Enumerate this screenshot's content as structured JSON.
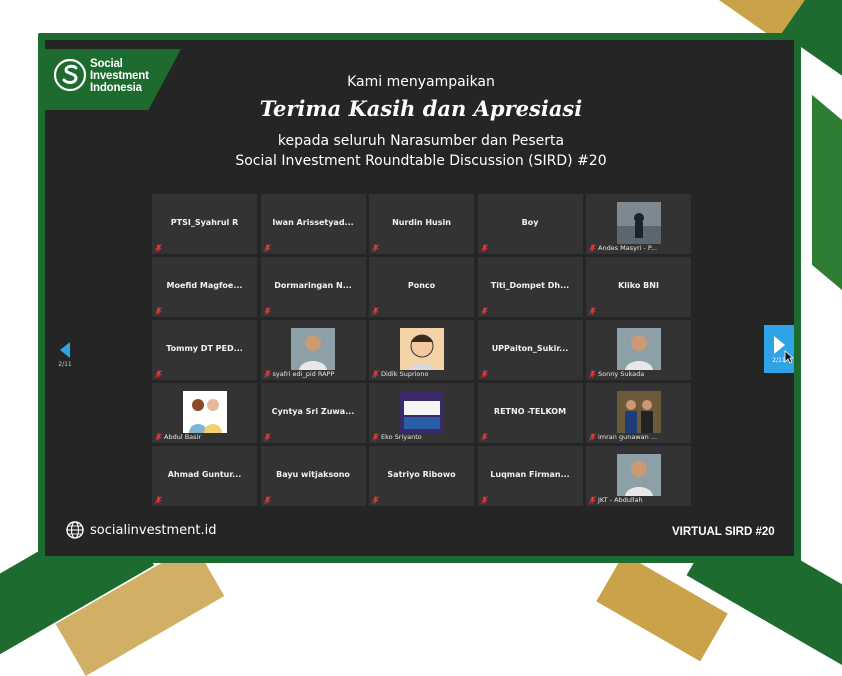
{
  "brand": {
    "logo_lines": [
      "Social",
      "Investment",
      "Indonesia"
    ],
    "green": "#1d6b2f",
    "gold": "#c9a24a"
  },
  "heading": {
    "line1": "Kami menyampaikan",
    "line2": "Terima Kasih dan Apresiasi",
    "line3": "kepada seluruh Narasumber dan Peserta",
    "line4": "Social Investment Roundtable Discussion (SIRD) #20"
  },
  "navigation": {
    "prev_page": "2/11",
    "next_page": "2/11"
  },
  "participants": [
    {
      "name": "PTSI_Syahrul R",
      "label": ""
    },
    {
      "name": "Iwan Arissetyad...",
      "label": ""
    },
    {
      "name": "Nurdin Husin",
      "label": ""
    },
    {
      "name": "Boy",
      "label": ""
    },
    {
      "name": "",
      "label": "Andes Masyri - P...",
      "photo": "silhouette-photo"
    },
    {
      "name": "Moefid Magfoe...",
      "label": ""
    },
    {
      "name": "Dormaringan N...",
      "label": ""
    },
    {
      "name": "Ponco",
      "label": ""
    },
    {
      "name": "Titi_Dompet Dh...",
      "label": ""
    },
    {
      "name": "Kliko BNI",
      "label": ""
    },
    {
      "name": "Tommy DT PED...",
      "label": ""
    },
    {
      "name": "",
      "label": "syafri edi_pid RAPP",
      "photo": "person-photo"
    },
    {
      "name": "",
      "label": "Didik Supriono",
      "photo": "cartoon-avatar"
    },
    {
      "name": "UPPaiton_Sukir...",
      "label": ""
    },
    {
      "name": "",
      "label": "Sonny Sukada",
      "photo": "person-photo"
    },
    {
      "name": "",
      "label": "Abdul Basir",
      "photo": "cartoon-couple"
    },
    {
      "name": "Cyntya Sri Zuwa...",
      "label": ""
    },
    {
      "name": "",
      "label": "Eko Sriyanto",
      "photo": "banner-photo"
    },
    {
      "name": "RETNO -TELKOM",
      "label": ""
    },
    {
      "name": "",
      "label": "imran gunawan ...",
      "photo": "group-photo"
    },
    {
      "name": "Ahmad Guntur...",
      "label": ""
    },
    {
      "name": "Bayu witjaksono",
      "label": ""
    },
    {
      "name": "Satriyo Ribowo",
      "label": ""
    },
    {
      "name": "Luqman Firman...",
      "label": ""
    },
    {
      "name": "",
      "label": "JKT - Abdullah",
      "photo": "person-photo"
    }
  ],
  "footer": {
    "website": "socialinvestment.id",
    "event_tag": "VIRTUAL SIRD #20"
  }
}
